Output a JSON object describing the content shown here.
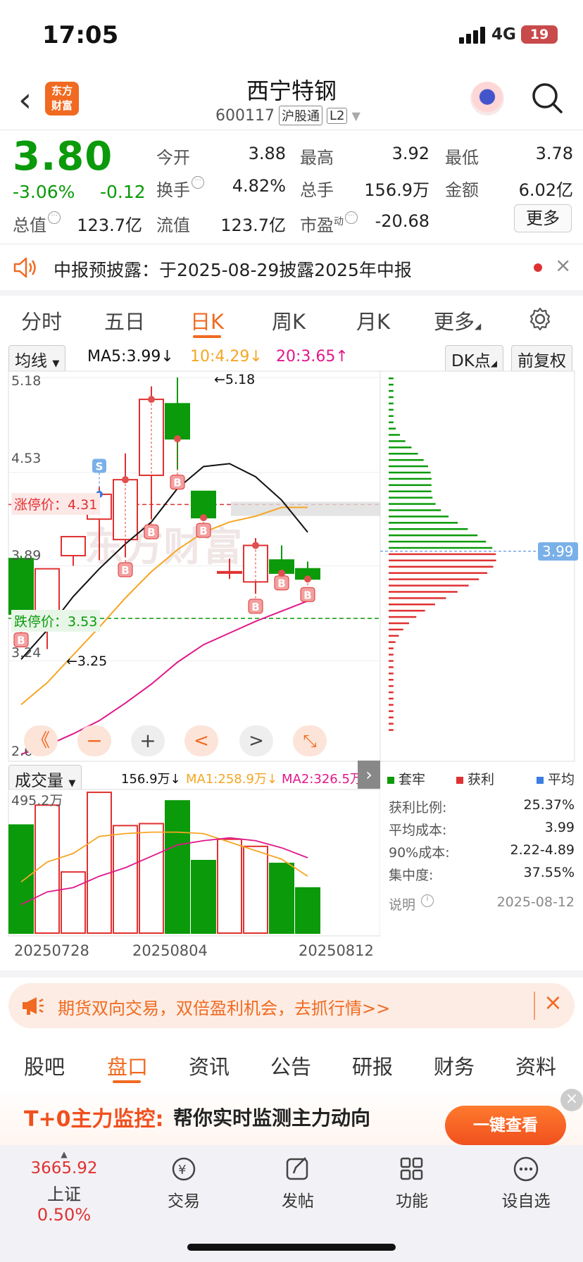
{
  "status": {
    "time": "17:05",
    "network": "4G",
    "battery": "19"
  },
  "header": {
    "title": "西宁特钢",
    "code": "600117",
    "tag1": "沪股通",
    "tag2": "L2"
  },
  "quote": {
    "price": "3.80",
    "pct": "-3.06%",
    "chg": "-0.12",
    "open_label": "今开",
    "open": "3.88",
    "high_label": "最高",
    "high": "3.92",
    "low_label": "最低",
    "low": "3.78",
    "turnover_label": "换手",
    "turnover": "4.82%",
    "volume_label": "总手",
    "volume": "156.9万",
    "amount_label": "金额",
    "amount": "6.02亿",
    "mcap_label": "总值",
    "mcap": "123.7亿",
    "float_label": "流值",
    "float": "123.7亿",
    "pe_label": "市盈",
    "pe_sup": "动",
    "pe": "-20.68",
    "more": "更多"
  },
  "notice": {
    "text": "中报预披露：于2025-08-29披露2025年中报"
  },
  "kline_tabs": [
    "分时",
    "五日",
    "日K",
    "周K",
    "月K",
    "更多"
  ],
  "active_kline_tab": 2,
  "ma": {
    "select": "均线",
    "ma5": "MA5:3.99↓",
    "ma10": "10:4.29↓",
    "ma20": "20:3.65↑",
    "dk": "DK点",
    "adjust": "前复权"
  },
  "chart": {
    "y_ticks": [
      "5.18",
      "4.53",
      "3.89",
      "3.24",
      "2.60"
    ],
    "limit_up": "涨停价：4.31",
    "limit_down": "跌停价：3.53",
    "max_label": "←5.18",
    "min_label": "←3.25",
    "cost_badge": "3.99",
    "watermark": "东方财富"
  },
  "chart_data": {
    "type": "candlestick",
    "ylim": [
      2.6,
      5.18
    ],
    "candles": [
      {
        "o": 3.94,
        "h": 3.96,
        "l": 3.47,
        "c": 3.56
      },
      {
        "o": 3.49,
        "h": 3.87,
        "l": 3.32,
        "c": 3.87
      },
      {
        "o": 3.96,
        "h": 4.04,
        "l": 3.89,
        "c": 4.09
      },
      {
        "o": 4.21,
        "h": 4.43,
        "l": 3.93,
        "c": 4.38
      },
      {
        "o": 4.07,
        "h": 4.66,
        "l": 3.95,
        "c": 4.48
      },
      {
        "o": 4.51,
        "h": 5.12,
        "l": 4.21,
        "c": 5.03
      },
      {
        "o": 5.0,
        "h": 5.18,
        "l": 4.55,
        "c": 4.76
      },
      {
        "o": 4.4,
        "h": 4.4,
        "l": 4.22,
        "c": 4.22
      },
      {
        "o": 3.85,
        "h": 3.94,
        "l": 3.8,
        "c": 3.85
      },
      {
        "o": 3.78,
        "h": 4.08,
        "l": 3.7,
        "c": 4.03
      },
      {
        "o": 3.93,
        "h": 4.03,
        "l": 3.86,
        "c": 3.84
      },
      {
        "o": 3.87,
        "h": 3.92,
        "l": 3.78,
        "c": 3.8
      }
    ],
    "ma5": [
      3.25,
      3.45,
      3.68,
      3.87,
      4.04,
      4.19,
      4.42,
      4.57,
      4.59,
      4.5,
      4.34,
      4.12
    ],
    "ma10": [
      2.94,
      3.09,
      3.28,
      3.47,
      3.67,
      3.85,
      4.0,
      4.12,
      4.19,
      4.23,
      4.29,
      4.29
    ],
    "ma20": [
      2.6,
      2.66,
      2.74,
      2.83,
      2.95,
      3.08,
      3.23,
      3.35,
      3.43,
      3.51,
      3.58,
      3.65
    ],
    "signals": [
      "B",
      "",
      "",
      "S",
      "B",
      "B",
      "B",
      "B",
      "",
      "B",
      "B",
      "B"
    ],
    "volume": {
      "values": [
        380,
        450,
        215,
        495,
        378,
        385,
        465,
        255,
        330,
        305,
        245,
        159
      ],
      "ma1": [
        180,
        250,
        280,
        340,
        350,
        355,
        355,
        350,
        320,
        290,
        260,
        200
      ],
      "ma2": [
        100,
        145,
        160,
        200,
        230,
        270,
        310,
        325,
        335,
        325,
        300,
        265
      ],
      "ylim": [
        0,
        495.2
      ]
    },
    "x_labels": [
      "20250728",
      "20250804",
      "20250812"
    ]
  },
  "controls": [
    "《",
    "−",
    "+",
    "<",
    ">",
    "⤡"
  ],
  "vol": {
    "select": "成交量",
    "val": "156.9万↓",
    "ma1": "MA1:258.9万↓",
    "ma2": "MA2:326.5万↓",
    "max": "495.2万"
  },
  "chip": {
    "legend_trapped": "套牢",
    "legend_profit": "获利",
    "legend_avg": "平均",
    "rows": [
      [
        "获利比例:",
        "25.37%"
      ],
      [
        "平均成本:",
        "3.99"
      ],
      [
        "90%成本:",
        "2.22-4.89"
      ],
      [
        "集中度:",
        "37.55%"
      ]
    ],
    "note": "说明",
    "date": "2025-08-12"
  },
  "banner": {
    "text": "期货双向交易，双倍盈利机会，去抓行情>>"
  },
  "tabs2": [
    "股吧",
    "盘口",
    "资讯",
    "公告",
    "研报",
    "财务",
    "资料"
  ],
  "active_tab2": 1,
  "ad": {
    "t0": "T+0主力监控:",
    "text": "帮你实时监测主力动向",
    "btn": "一键查看"
  },
  "bottom": {
    "index_val": "3665.92",
    "index_name": "上证",
    "index_pct": "0.50%",
    "trade": "交易",
    "post": "发帖",
    "func": "功能",
    "watch": "设自选"
  },
  "colors": {
    "up": "#e03131",
    "down": "#0a9a0a",
    "accent": "#f06a21",
    "ma5": "#111111",
    "ma10": "#f5a623",
    "ma20": "#e0188a"
  }
}
